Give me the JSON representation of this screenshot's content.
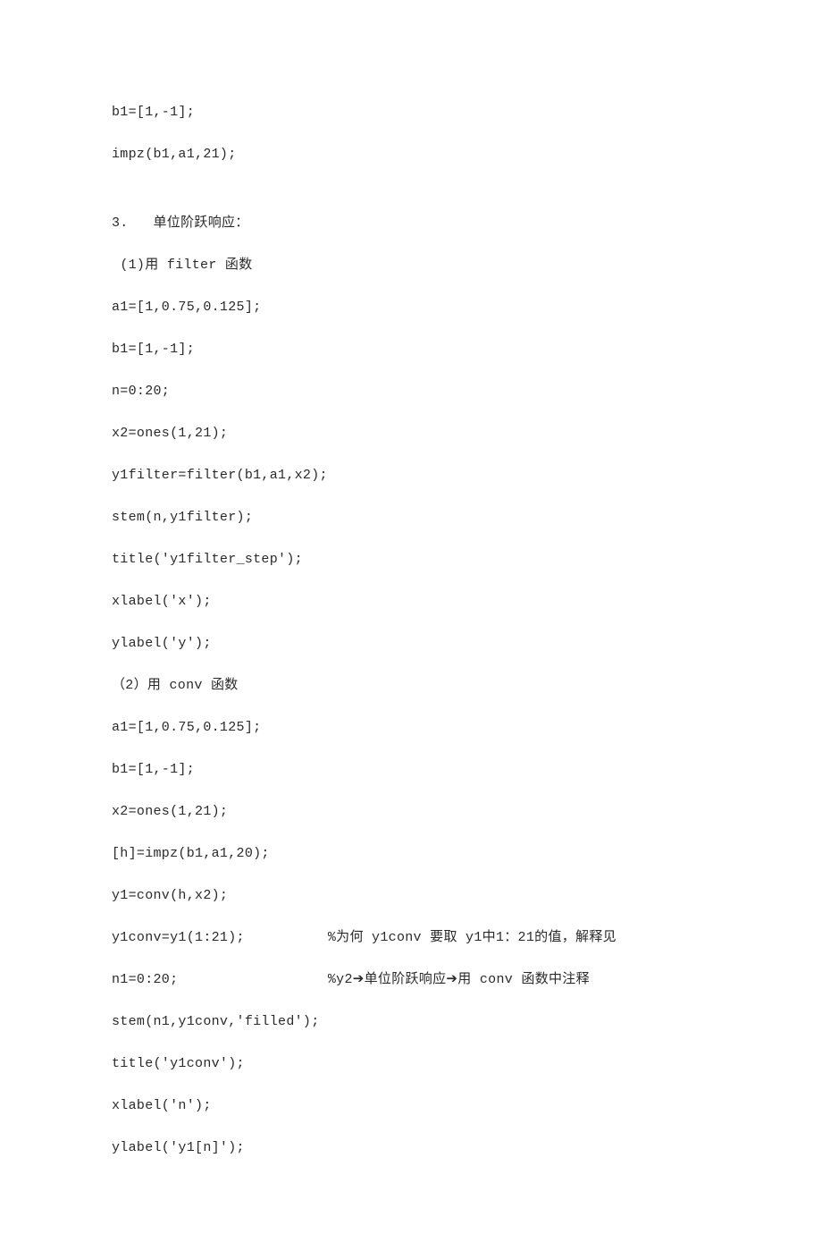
{
  "lines": [
    "b1=[1,-1];",
    "impz(b1,a1,21);",
    "",
    "3.   单位阶跃响应：",
    " (1)用 filter 函数",
    "a1=[1,0.75,0.125];",
    "b1=[1,-1];",
    "n=0:20;",
    "x2=ones(1,21);",
    "y1filter=filter(b1,a1,x2);",
    "stem(n,y1filter);",
    "title('y1filter_step');",
    "xlabel('x');",
    "ylabel('y');",
    "（2）用 conv 函数",
    "a1=[1,0.75,0.125];",
    "b1=[1,-1];",
    "x2=ones(1,21);",
    "[h]=impz(b1,a1,20);",
    "y1=conv(h,x2);",
    "y1conv=y1(1:21);          %为何 y1conv 要取 y1中1：21的值，解释见",
    "n1=0:20;                  %y2➔单位阶跃响应➔用 conv 函数中注释",
    "stem(n1,y1conv,'filled');",
    "title('y1conv');",
    "xlabel('n');",
    "ylabel('y1[n]');"
  ]
}
